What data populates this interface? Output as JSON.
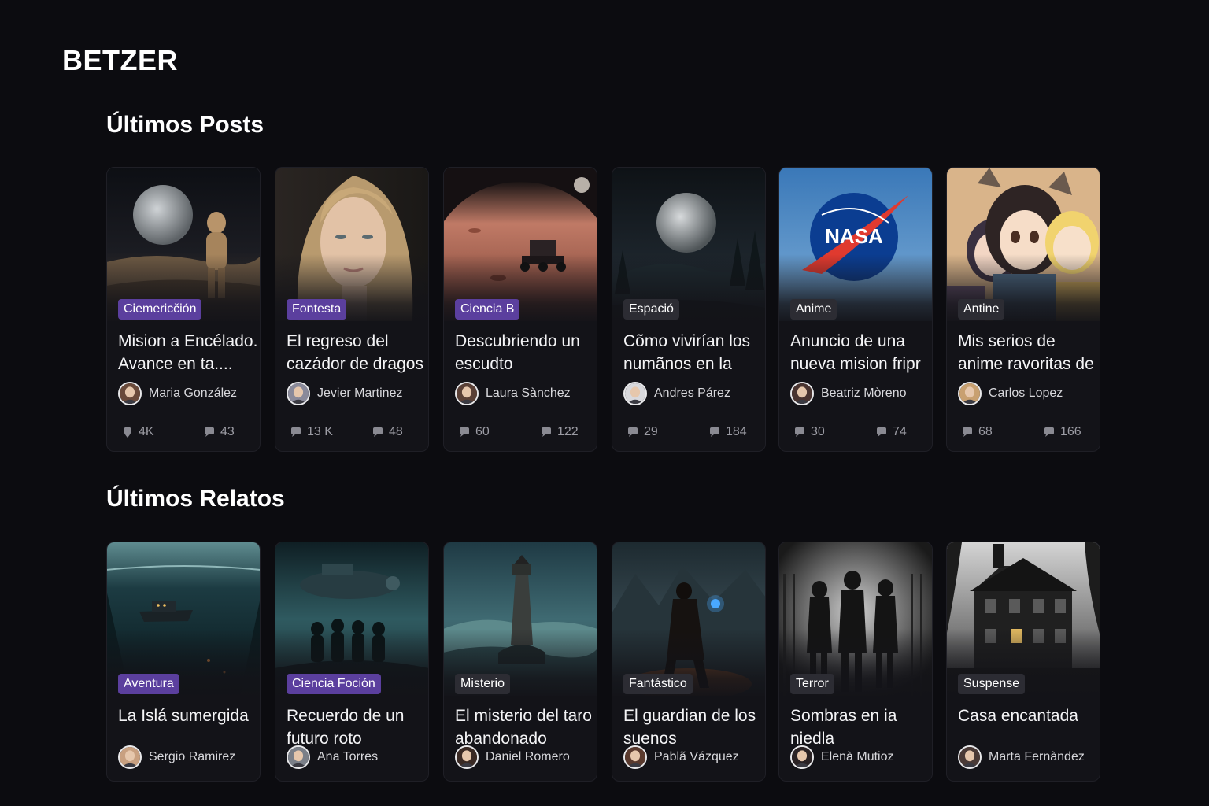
{
  "brand": {
    "name": "BETZER"
  },
  "posts": {
    "title": "Últimos Posts",
    "items": [
      {
        "tag": "Ciemericčión",
        "tag_color": "#5b3f9e",
        "title": "Mision a Encélado. Avance en ta....",
        "author": "Maria González",
        "icon_a": "pin-icon",
        "stat_a": "4K",
        "icon_b": "comment-icon",
        "stat_b": "43",
        "image": "astronaut-on-moon-image"
      },
      {
        "tag": "Fontesta",
        "tag_color": "#5b3f9e",
        "title": "El regreso del cazádor de dragos",
        "author": "Jevier Martinez",
        "icon_a": "comment-icon",
        "stat_a": "13 K",
        "icon_b": "comment-icon",
        "stat_b": "48",
        "image": "woman-portrait-image"
      },
      {
        "tag": "Ciencia B",
        "tag_color": "#5b3f9e",
        "title": "Descubriendo un escudto",
        "author": "Laura Sànchez",
        "icon_a": "comment-icon",
        "stat_a": "60",
        "icon_b": "comment-icon",
        "stat_b": "122",
        "image": "mars-rover-image"
      },
      {
        "tag": "Espació",
        "tag_color": "#2c2c33",
        "title": "Cõmo vivirían los numãnos en la",
        "author": "Andres Párez",
        "icon_a": "comment-icon",
        "stat_a": "29",
        "icon_b": "comment-icon",
        "stat_b": "184",
        "image": "moon-over-forest-image"
      },
      {
        "tag": "Anime",
        "tag_color": "#2c2c33",
        "title": "Anuncio de una nueva mision fripr",
        "author": "Beatriz Mòreno",
        "icon_a": "comment-icon",
        "stat_a": "30",
        "icon_b": "comment-icon",
        "stat_b": "74",
        "image": "nasa-logo-image",
        "image_text": "NASA"
      },
      {
        "tag": "Antine",
        "tag_color": "#2c2c33",
        "title": "Mis serios de anime ravoritas de",
        "author": "Carlos Lopez",
        "icon_a": "comment-icon",
        "stat_a": "68",
        "icon_b": "comment-icon",
        "stat_b": "166",
        "image": "anime-girls-image"
      }
    ]
  },
  "stories": {
    "title": "Últimos Relatos",
    "items": [
      {
        "tag": "Aventura",
        "tag_color": "#5b3f9e",
        "title": "La Islá sumergida",
        "author": "Sergio Ramirez",
        "image": "underwater-ship-image"
      },
      {
        "tag": "Ciencia Foción",
        "tag_color": "#5b3f9e",
        "title": "Recuerdo de un futuro roto",
        "author": "Ana Torres",
        "image": "spaceship-silhouettes-image"
      },
      {
        "tag": "Misterio",
        "tag_color": "#2c2c33",
        "title": "El misterio del taro abandonado",
        "author": "Daniel Romero",
        "image": "lighthouse-storm-image"
      },
      {
        "tag": "Fantástico",
        "tag_color": "#2c2c33",
        "title": "El guardian de los suenos",
        "author": "Pablã Vázquez",
        "image": "guardian-warrior-image"
      },
      {
        "tag": "Terror",
        "tag_color": "#2c2c33",
        "title": "Sombras en ia niedla",
        "author": "Elenà Mutioz",
        "image": "shadow-figures-fog-image"
      },
      {
        "tag": "Suspense",
        "tag_color": "#2c2c33",
        "title": "Casa encantada",
        "author": "Marta Fernàndez",
        "image": "haunted-house-image"
      }
    ]
  }
}
